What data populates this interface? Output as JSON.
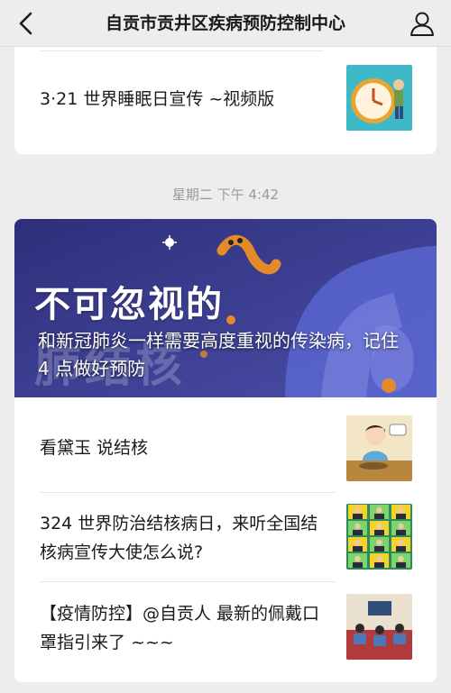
{
  "header": {
    "title": "自贡市贡井区疾病预防控制中心",
    "back_icon": "chevron-left-icon",
    "profile_icon": "person-icon"
  },
  "message1": {
    "articles": [
      {
        "title": "3·21 世界睡眠日宣传 ~视频版",
        "thumb": "clock-cartoon"
      }
    ]
  },
  "timestamp": "星期二 下午 4:42",
  "message2": {
    "cover": {
      "headline": "不可忽视的",
      "watermark": "肺结核",
      "title": "和新冠肺炎一样需要高度重视的传染病，记住 4 点做好预防"
    },
    "articles": [
      {
        "title": "看黛玉 说结核",
        "thumb": "lady-cartoon"
      },
      {
        "title": "324 世界防治结核病日，来听全国结核病宣传大使怎么说?",
        "thumb": "portrait-grid"
      },
      {
        "title": "【疫情防控】@自贡人 最新的佩戴口罩指引来了 ~~~",
        "thumb": "classroom-cartoon"
      }
    ]
  },
  "colors": {
    "background": "#ededed",
    "card": "#ffffff",
    "hero_bg": "#3d3f96"
  }
}
